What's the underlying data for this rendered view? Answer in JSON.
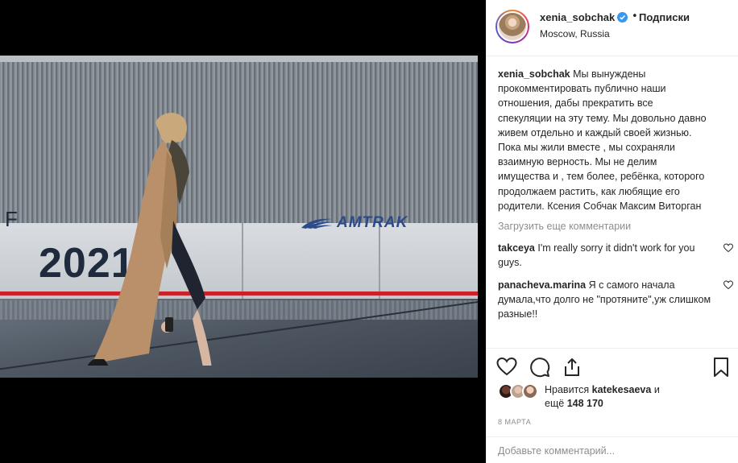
{
  "post": {
    "username": "xenia_sobchak",
    "dot": "•",
    "follow_label": "Подписки",
    "location": "Moscow, Russia",
    "photo": {
      "car_letter": "F",
      "car_number": "2021",
      "brand": "AMTRAK"
    }
  },
  "caption": {
    "author": "xenia_sobchak",
    "text": "Мы вынуждены прокомментировать публично наши отношения, дабы прекратить все спекуляции на эту тему. Мы довольно давно живем отдельно и каждый своей жизнью. Пока мы жили вместе , мы сохраняли взаимную верность. Мы не делим имущества и , тем более, ребёнка, которого продолжаем растить, как любящие его родители. Ксения Собчак Максим Виторган"
  },
  "load_more": "Загрузить еще комментарии",
  "comments": [
    {
      "author": "takceya",
      "text": "I'm really sorry it didn't work for you guys."
    },
    {
      "author": "panacheva.marina",
      "text": "Я с самого начала думала,что долго не \"протяните\",уж слишком разные!!"
    }
  ],
  "likes": {
    "prefix": "Нравится",
    "liker": "katekesaeva",
    "and": "и",
    "rest_prefix": "ещё",
    "count": "148 170"
  },
  "date": "8 марта",
  "add_comment_placeholder": "Добавьте комментарий...",
  "icons": {
    "verified": "verified-badge-icon",
    "like": "heart-icon",
    "comment": "comment-icon",
    "share": "share-icon",
    "save": "bookmark-icon"
  },
  "colors": {
    "verified_blue": "#3897f0",
    "amtrak_blue": "#2b4a8a",
    "stripe_red": "#c8232c",
    "muted_text": "#8e8e8e"
  }
}
